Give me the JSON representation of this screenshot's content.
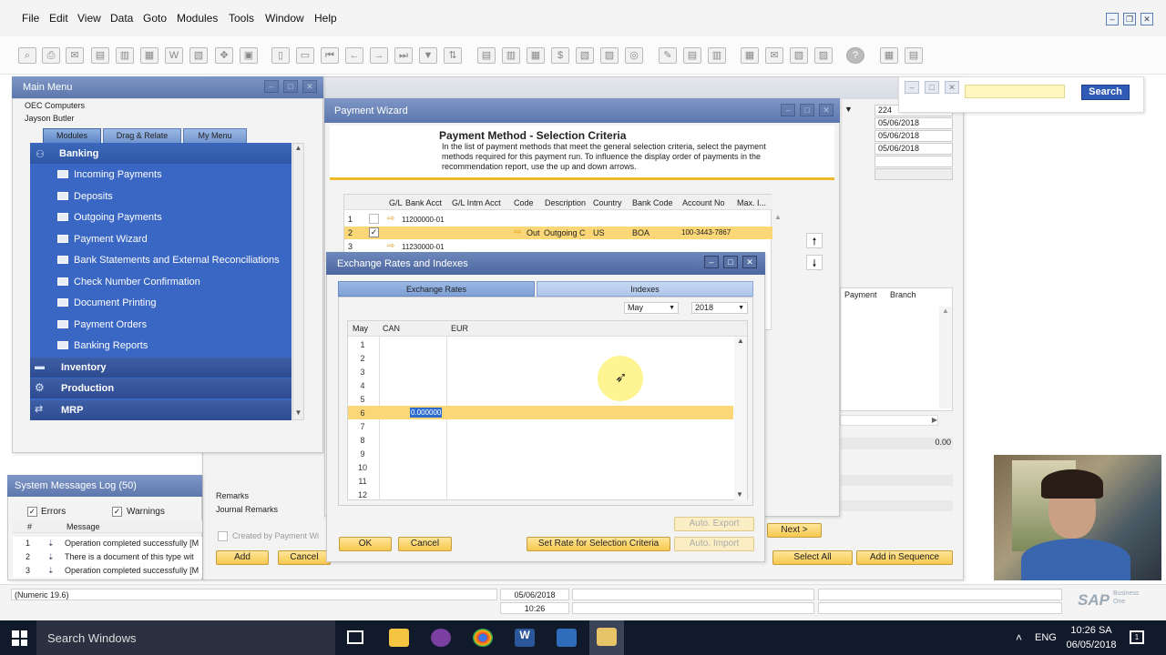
{
  "menu": {
    "items": [
      "File",
      "Edit",
      "View",
      "Data",
      "Goto",
      "Modules",
      "Tools",
      "Window",
      "Help"
    ]
  },
  "main_menu": {
    "title": "Main Menu",
    "company": "OEC Computers",
    "user": "Jayson Butler",
    "tabs": [
      "Modules",
      "Drag & Relate",
      "My Menu"
    ],
    "banking_header": "Banking",
    "items": [
      "Incoming Payments",
      "Deposits",
      "Outgoing Payments",
      "Payment Wizard",
      "Bank Statements and External Reconciliations",
      "Check Number Confirmation",
      "Document Printing",
      "Payment Orders",
      "Banking Reports"
    ],
    "sections": [
      "Inventory",
      "Production",
      "MRP"
    ]
  },
  "messages": {
    "title": "System Messages Log (50)",
    "errors_label": "Errors",
    "warnings_label": "Warnings",
    "col_num": "#",
    "col_msg": "Message",
    "rows": [
      {
        "n": "1",
        "text": "Operation completed successfully  [M"
      },
      {
        "n": "2",
        "text": "There is a document of this type wit"
      },
      {
        "n": "3",
        "text": "Operation completed successfully  [M"
      }
    ]
  },
  "back_window": {
    "remarks": "Remarks",
    "journal_remarks": "Journal Remarks",
    "created_by": "Created by Payment Wi",
    "add": "Add",
    "cancel": "Cancel",
    "fields": [
      "224",
      "05/06/2018",
      "05/06/2018",
      "05/06/2018"
    ],
    "search_button": "Search",
    "col_payment": "Payment",
    "col_branch": "Branch",
    "total": "0.00",
    "select_all": "Select All",
    "add_in_sequence": "Add in Sequence"
  },
  "wizard": {
    "title": "Payment Wizard",
    "heading": "Payment Method - Selection Criteria",
    "desc": "In the list of payment methods that meet the general selection criteria, select the payment methods required for this payment run. To influence the display order of payments in the recommendation report,  use the up and down arrows.",
    "columns": [
      "",
      "",
      "G/L",
      "Bank Acct",
      "G/L Intm Acct",
      "Code",
      "Description",
      "Country",
      "Bank Code",
      "Account No",
      "Max. I..."
    ],
    "rows": [
      {
        "n": "1",
        "gl": "11200000-01",
        "code": "",
        "desc": "",
        "country": "",
        "bank": "",
        "acct": ""
      },
      {
        "n": "2",
        "gl": "",
        "code": "Out",
        "desc": "Outgoing C",
        "country": "US",
        "bank": "BOA",
        "acct": "100-3443-7867"
      },
      {
        "n": "3",
        "gl": "11230000-01",
        "code": "",
        "desc": "",
        "country": "",
        "bank": "",
        "acct": ""
      }
    ],
    "next": "Next >"
  },
  "exchange": {
    "title": "Exchange Rates and Indexes",
    "tabs": [
      "Exchange Rates",
      "Indexes"
    ],
    "month": "May",
    "year": "2018",
    "col_month": "May",
    "col_can": "CAN",
    "col_eur": "EUR",
    "rows": [
      "1",
      "2",
      "3",
      "4",
      "5",
      "6",
      "7",
      "8",
      "9",
      "10",
      "11",
      "12"
    ],
    "selected_value": "0.000000",
    "ok": "OK",
    "cancel": "Cancel",
    "set_rate": "Set Rate for Selection Criteria",
    "auto_export": "Auto. Export",
    "auto_import": "Auto. Import"
  },
  "status": {
    "numeric": "(Numeric 19.6)",
    "date": "05/06/2018",
    "time": "10:26"
  },
  "taskbar": {
    "search": "Search Windows",
    "lang": "ENG",
    "clock_time": "10:26 SA",
    "clock_date": "06/05/2018",
    "notif": "1"
  },
  "brand": {
    "sap": "SAP",
    "business_one": "Business One"
  }
}
